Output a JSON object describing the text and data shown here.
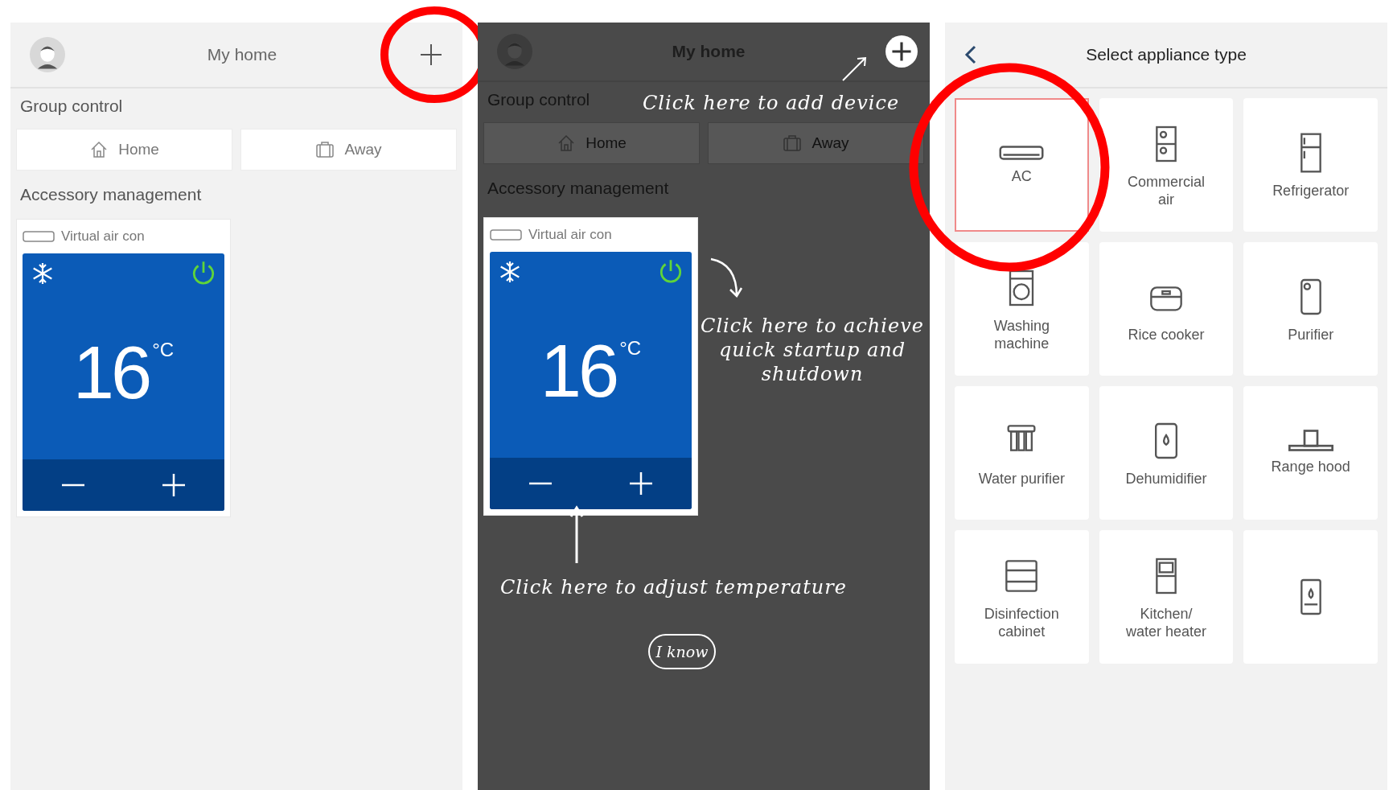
{
  "screens": [
    {
      "kind": "home",
      "title": "My home",
      "group_label": "Group control",
      "group_buttons": [
        "Home",
        "Away"
      ],
      "section_label": "Accessory management",
      "device": {
        "name": "Virtual air con",
        "temperature": "16",
        "unit": "°C",
        "power_on": true
      },
      "add_highlighted": true
    },
    {
      "kind": "tutorial",
      "title": "My home",
      "group_label": "Group control",
      "group_buttons": [
        "Home",
        "Away"
      ],
      "section_label": "Accessory management",
      "device": {
        "name": "Virtual air con",
        "temperature": "16",
        "unit": "°C",
        "power_on": true
      },
      "add_highlighted": false,
      "hints": [
        "Click here to add device",
        "Click here to achieve quick startup and shutdown",
        "Click here to adjust temperature"
      ],
      "dismiss_button": "I know"
    },
    {
      "kind": "picker",
      "title": "Select appliance type",
      "items": [
        {
          "label": "AC",
          "selected": true
        },
        {
          "label": "Commercial air",
          "selected": false
        },
        {
          "label": "Refrigerator",
          "selected": false
        },
        {
          "label": "Washing machine",
          "selected": false
        },
        {
          "label": "Rice cooker",
          "selected": false
        },
        {
          "label": "Purifier",
          "selected": false
        },
        {
          "label": "Water purifier",
          "selected": false
        },
        {
          "label": "Dehumidifier",
          "selected": false
        },
        {
          "label": "Range hood",
          "selected": false
        },
        {
          "label": "Disinfection cabinet",
          "selected": false
        },
        {
          "label": "Kitchen/ water heater",
          "selected": false
        },
        {
          "selected": false
        }
      ]
    }
  ]
}
